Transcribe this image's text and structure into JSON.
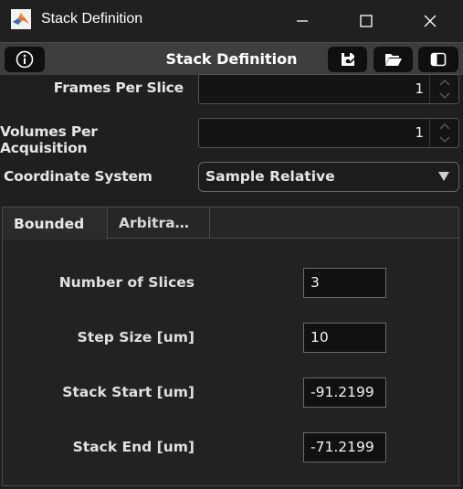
{
  "window": {
    "title": "Stack Definition",
    "icon": "matlab-icon",
    "controls": [
      "minimize-icon",
      "maximize-icon",
      "close-icon"
    ]
  },
  "toolbar": {
    "title": "Stack Definition",
    "buttons": [
      "info-icon",
      "save-icon",
      "folder-open-icon",
      "panel-toggle-icon"
    ]
  },
  "form": {
    "frames_per_slice": {
      "label": "Frames Per Slice",
      "value": "1"
    },
    "volumes_per_acquisition": {
      "label": "Volumes Per Acquisition",
      "value": "1"
    },
    "coordinate_system": {
      "label": "Coordinate System",
      "selected": "Sample Relative"
    }
  },
  "tabs": [
    {
      "label": "Bounded",
      "active": true
    },
    {
      "label": "Arbitra…",
      "active": false
    }
  ],
  "bounded": {
    "number_of_slices": {
      "label": "Number of Slices",
      "value": "3"
    },
    "step_size": {
      "label": "Step Size [um]",
      "value": "10"
    },
    "stack_start": {
      "label": "Stack Start [um]",
      "value": "-91.2199"
    },
    "stack_end": {
      "label": "Stack End [um]",
      "value": "-71.2199"
    }
  }
}
